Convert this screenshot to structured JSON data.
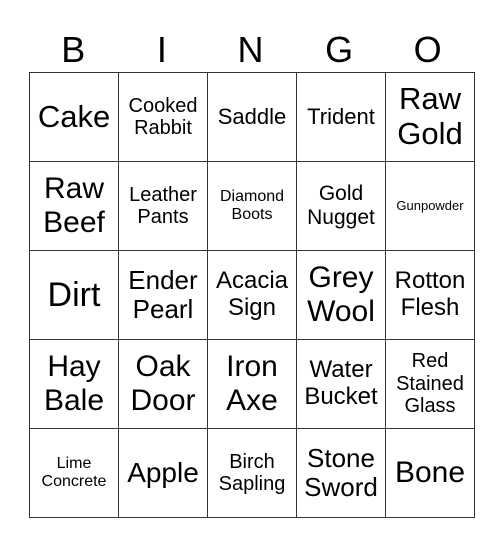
{
  "header": [
    "B",
    "I",
    "N",
    "G",
    "O"
  ],
  "cells": [
    [
      "Cake",
      "Cooked Rabbit",
      "Saddle",
      "Trident",
      "Raw Gold"
    ],
    [
      "Raw Beef",
      "Leather Pants",
      "Diamond Boots",
      "Gold Nugget",
      "Gunpowder"
    ],
    [
      "Dirt",
      "Ender Pearl",
      "Acacia Sign",
      "Grey Wool",
      "Rotton Flesh"
    ],
    [
      "Hay Bale",
      "Oak Door",
      "Iron Axe",
      "Water Bucket",
      "Red Stained Glass"
    ],
    [
      "Lime Concrete",
      "Apple",
      "Birch Sapling",
      "Stone Sword",
      "Bone"
    ]
  ]
}
